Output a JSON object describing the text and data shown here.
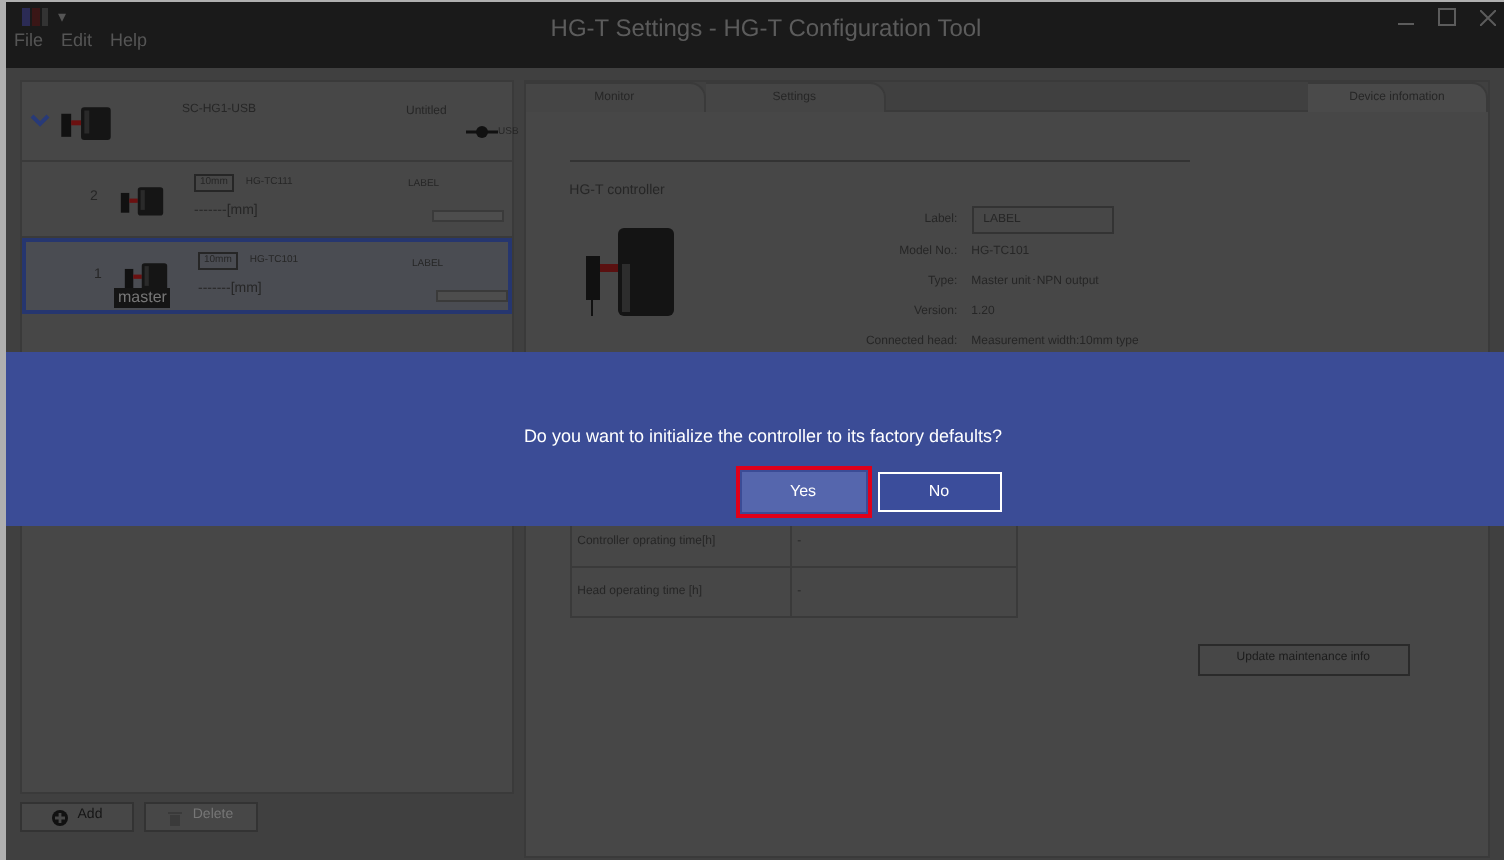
{
  "window": {
    "title": "HG-T Settings - HG-T Configuration Tool",
    "quick_access": "▾"
  },
  "menu": [
    "File",
    "Edit",
    "Help"
  ],
  "device_tree": {
    "expanded": true,
    "name": "SC-HG1-USB",
    "title": "Untitled",
    "port": "USB",
    "units": [
      {
        "number": "2",
        "width": "10mm",
        "model": "HG-TC111",
        "label": "LABEL",
        "reading": "-------[mm]",
        "selected": false
      },
      {
        "number": "1",
        "width": "10mm",
        "model": "HG-TC101",
        "label": "LABEL",
        "reading": "-------[mm]",
        "master": "master",
        "selected": true
      }
    ]
  },
  "tree_buttons": [
    {
      "label": "Add",
      "kind": "add",
      "disabled": false
    },
    {
      "label": "Delete",
      "kind": "delete",
      "disabled": true
    }
  ],
  "tabs": [
    {
      "label": "Monitor",
      "selected": false
    },
    {
      "label": "Settings",
      "selected": false
    },
    {
      "label": "Device infomation",
      "selected": true
    }
  ],
  "device_info": {
    "heading": "HG-T controller",
    "label_field": {
      "label": "Label:",
      "value": "LABEL"
    },
    "fields": [
      {
        "label": "Model No.:",
        "value": "HG-TC101"
      },
      {
        "label": "Type:",
        "value": "Master unit･NPN output"
      },
      {
        "label": "Version:",
        "value": "1.20"
      },
      {
        "label": "Connected head:",
        "value": "Measurement width:10mm type"
      }
    ],
    "maintenance": {
      "rows": [
        [
          "Controller oprating time[h]",
          "-"
        ],
        [
          "Head operating time [h]",
          "-"
        ]
      ]
    },
    "update_button": "Update maintenance info"
  },
  "dialog": {
    "message": "Do you want to initialize the controller to its factory defaults?",
    "buttons": [
      {
        "label": "Yes",
        "selected": true
      },
      {
        "label": "No",
        "selected": false
      }
    ]
  }
}
